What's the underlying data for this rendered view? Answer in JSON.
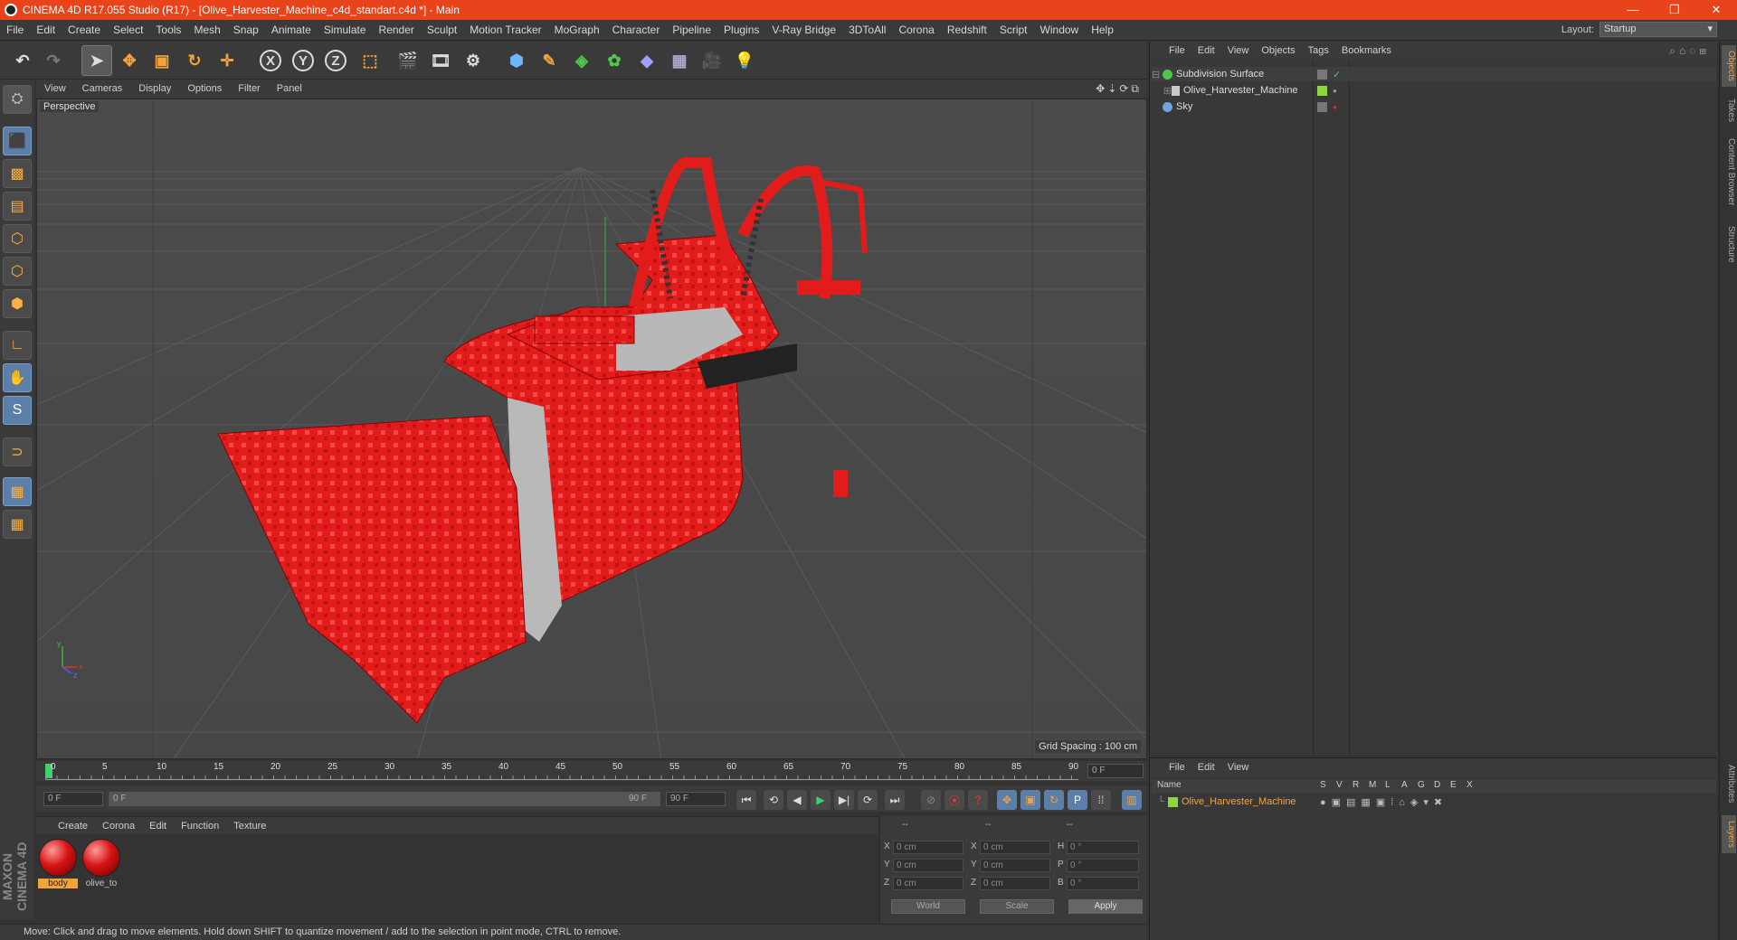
{
  "window": {
    "title": "CINEMA 4D R17.055 Studio (R17) - [Olive_Harvester_Machine_c4d_standart.c4d *] - Main",
    "buttons": [
      "—",
      "❐",
      "✕"
    ]
  },
  "menu": [
    "File",
    "Edit",
    "Create",
    "Select",
    "Tools",
    "Mesh",
    "Snap",
    "Animate",
    "Simulate",
    "Render",
    "Sculpt",
    "Motion Tracker",
    "MoGraph",
    "Character",
    "Pipeline",
    "Plugins",
    "V-Ray Bridge",
    "3DToAll",
    "Corona",
    "Redshift",
    "Script",
    "Window",
    "Help"
  ],
  "layout": {
    "label": "Layout:",
    "value": "Startup"
  },
  "toolbar": {
    "axis_x": "X",
    "axis_y": "Y",
    "axis_z": "Z",
    "icons": [
      "undo-icon",
      "redo-icon",
      "select-icon",
      "move-icon",
      "scale-icon",
      "rotate-icon",
      "move-transform-icon",
      "coord-system-icon",
      "render-view-icon",
      "render-picture-viewer-icon",
      "render-settings-icon",
      "cube-icon",
      "pen-icon",
      "subdivision-icon",
      "mograph-icon",
      "deformer-icon",
      "floor-icon",
      "camera-icon",
      "light-icon"
    ]
  },
  "viewport": {
    "menu": [
      "View",
      "Cameras",
      "Display",
      "Options",
      "Filter",
      "Panel"
    ],
    "label": "Perspective",
    "grid_spacing": "Grid Spacing : 100 cm",
    "axis_labels": {
      "y": "y",
      "x": "x",
      "z": "z"
    }
  },
  "timeline": {
    "ticks": [
      "0",
      "5",
      "10",
      "15",
      "20",
      "25",
      "30",
      "35",
      "40",
      "45",
      "50",
      "55",
      "60",
      "65",
      "70",
      "75",
      "80",
      "85",
      "90"
    ],
    "current_frame": "0 F",
    "start_field": "0 F",
    "range_start": "0 F",
    "range_end": "90 F",
    "end_field": "90 F"
  },
  "material_manager": {
    "menu": [
      "Create",
      "Corona",
      "Edit",
      "Function",
      "Texture"
    ],
    "materials": [
      {
        "name": "body",
        "active": true
      },
      {
        "name": "olive_to",
        "active": false
      }
    ]
  },
  "coordinates": {
    "headers": [
      "--",
      "--",
      "--"
    ],
    "rows": [
      {
        "l1": "X",
        "v1": "0 cm",
        "l2": "X",
        "v2": "0 cm",
        "l3": "H",
        "v3": "0 °"
      },
      {
        "l1": "Y",
        "v1": "0 cm",
        "l2": "Y",
        "v2": "0 cm",
        "l3": "P",
        "v3": "0 °"
      },
      {
        "l1": "Z",
        "v1": "0 cm",
        "l2": "Z",
        "v2": "0 cm",
        "l3": "B",
        "v3": "0 °"
      }
    ],
    "world": "World",
    "scale": "Scale",
    "apply": "Apply"
  },
  "status": "Move: Click and drag to move elements. Hold down SHIFT to quantize movement / add to the selection in point mode, CTRL to remove.",
  "object_manager": {
    "menu": [
      "File",
      "Edit",
      "View",
      "Objects",
      "Tags",
      "Bookmarks"
    ],
    "objects": [
      {
        "name": "Subdivision Surface",
        "color": "#4ec94e"
      },
      {
        "name": "Olive_Harvester_Machine",
        "color": "#c8c8c8"
      },
      {
        "name": "Sky",
        "color": "#6fa6e0"
      }
    ]
  },
  "layer_manager": {
    "menu": [
      "File",
      "Edit",
      "View"
    ],
    "columns": [
      "Name",
      "S",
      "V",
      "R",
      "M",
      "L",
      "A",
      "G",
      "D",
      "E",
      "X"
    ],
    "layers": [
      {
        "name": "Olive_Harvester_Machine",
        "color": "#8fd63a"
      }
    ]
  },
  "side_tabs": [
    "Objects",
    "Takes",
    "Content Browser",
    "Structure"
  ],
  "side_tabs_bottom": [
    "Attributes",
    "Layers"
  ],
  "branding": "MAXON CINEMA 4D",
  "colors": {
    "accent": "#e8431a",
    "selected_orange": "#f3a33a",
    "model_red": "#e01818"
  }
}
